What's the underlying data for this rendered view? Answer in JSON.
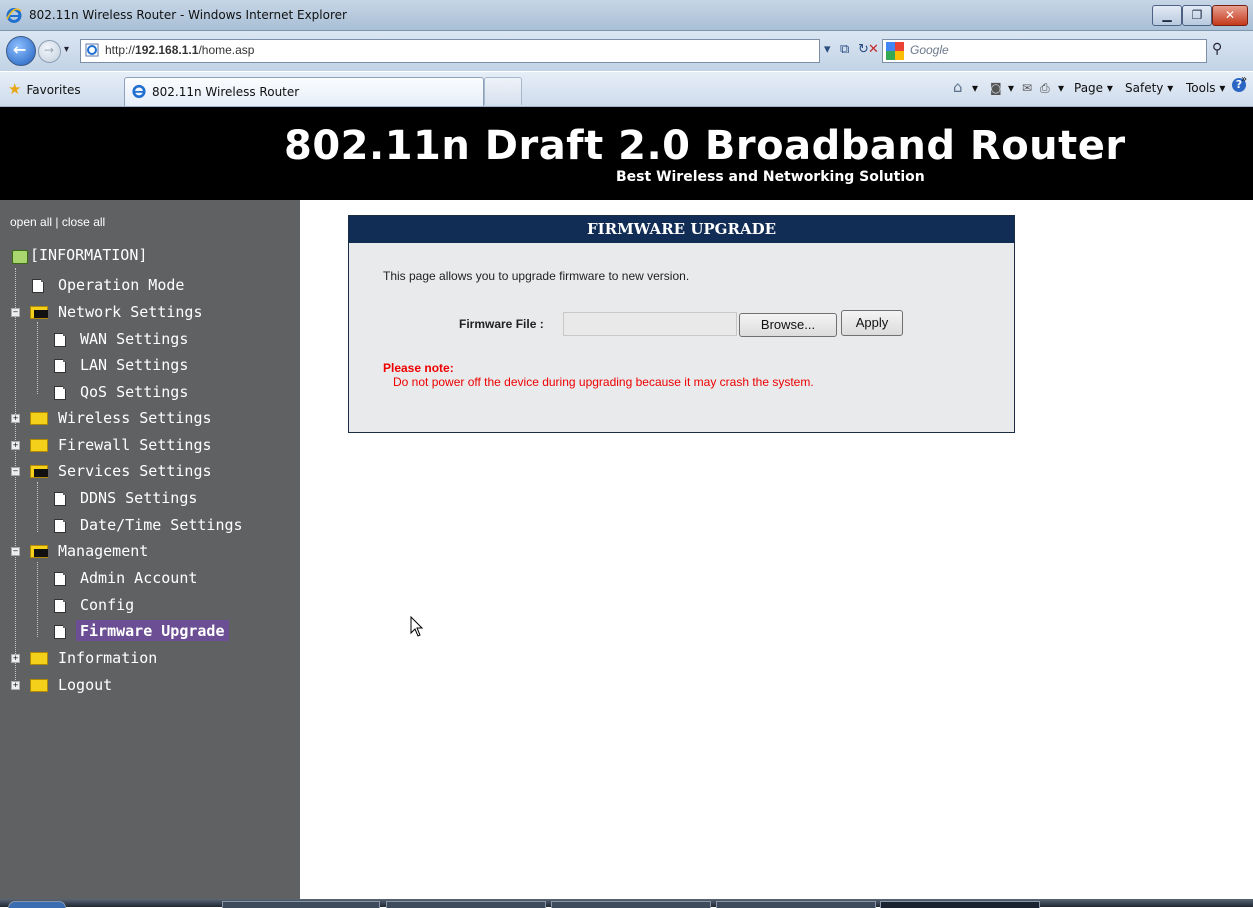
{
  "window": {
    "title": "802.11n Wireless Router - Windows Internet Explorer",
    "minimize_glyph": "▁",
    "maximize_glyph": "❐",
    "close_glyph": "✕"
  },
  "addressbar": {
    "url_prefix": "http://",
    "url_host": "192.168.1.1",
    "url_path": "/home.asp",
    "search_placeholder": "Google",
    "dropdown_glyph": "▾",
    "compat_glyph": "⧉",
    "refresh_glyph": "↻",
    "stop_glyph": "✕",
    "search_glyph": "⚲"
  },
  "commandbar": {
    "favorites_label": "Favorites",
    "tab_label": "802.11n Wireless Router",
    "home_glyph": "⌂",
    "feeds_glyph": "◙",
    "mail_glyph": "✉",
    "print_glyph": "⎙",
    "page_label": "Page ▾",
    "safety_label": "Safety ▾",
    "tools_label": "Tools ▾",
    "help_glyph": "?",
    "overflow_glyph": "»"
  },
  "header": {
    "title": "802.11n Draft 2.0  Broadband Router",
    "subtitle": "Best Wireless and Networking Solution"
  },
  "sidebar": {
    "open_all": "open all",
    "close_all": "close all",
    "root_label": "[INFORMATION]",
    "items": [
      {
        "label": "Operation Mode"
      },
      {
        "label": "Network Settings"
      },
      {
        "label": "WAN Settings"
      },
      {
        "label": "LAN Settings"
      },
      {
        "label": "QoS Settings"
      },
      {
        "label": "Wireless Settings"
      },
      {
        "label": "Firewall Settings"
      },
      {
        "label": "Services Settings"
      },
      {
        "label": "DDNS Settings"
      },
      {
        "label": "Date/Time Settings"
      },
      {
        "label": "Management"
      },
      {
        "label": "Admin Account"
      },
      {
        "label": "Config"
      },
      {
        "label": "Firmware Upgrade"
      },
      {
        "label": "Information"
      },
      {
        "label": "Logout"
      }
    ]
  },
  "firmware": {
    "heading": "FIRMWARE UPGRADE",
    "description": "This page allows you to upgrade firmware to new version.",
    "file_label": "Firmware File :",
    "file_value": "",
    "browse_label": "Browse...",
    "apply_label": "Apply",
    "note_title": "Please note:",
    "note_text": "Do not power off the device during upgrading because it may crash the system."
  },
  "colors": {
    "sidebar_bg": "#5f6163",
    "panel_header": "#112d55",
    "selected_item": "#6b4e93",
    "note_red": "#ee0000"
  }
}
